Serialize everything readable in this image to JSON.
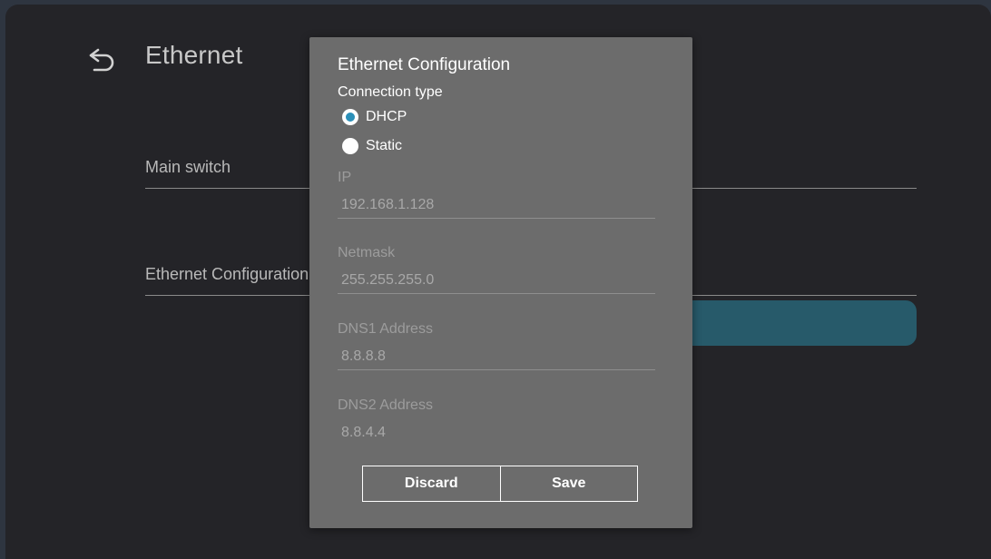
{
  "header": {
    "title": "Ethernet",
    "back_icon": "back-arrow-icon"
  },
  "settings": {
    "main_switch_label": "Main switch",
    "ethernet_config_label": "Ethernet Configuration"
  },
  "colors": {
    "background": "#242428",
    "dialog": "#6c6c6c",
    "accent": "#2b8fb8",
    "highlight": "#275a6a"
  },
  "dialog": {
    "title": "Ethernet Configuration",
    "connection_type_label": "Connection type",
    "options": [
      {
        "label": "DHCP",
        "selected": true
      },
      {
        "label": "Static",
        "selected": false
      }
    ],
    "fields": {
      "ip": {
        "label": "IP",
        "value": "192.168.1.128"
      },
      "netmask": {
        "label": "Netmask",
        "value": "255.255.255.0"
      },
      "dns1": {
        "label": "DNS1 Address",
        "value": "8.8.8.8"
      },
      "dns2": {
        "label": "DNS2 Address",
        "value": "8.8.4.4"
      }
    },
    "buttons": {
      "discard": "Discard",
      "save": "Save"
    }
  }
}
